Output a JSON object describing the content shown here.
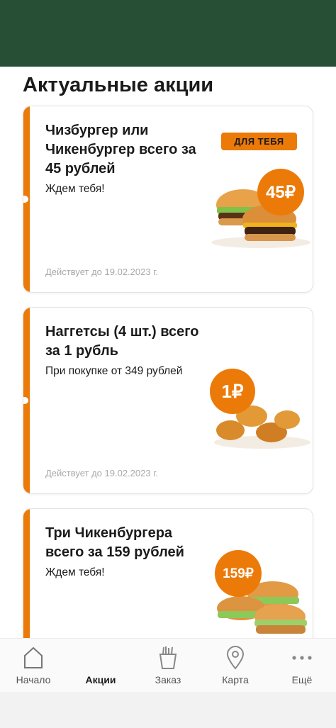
{
  "page": {
    "title": "Актуальные акции"
  },
  "promos": [
    {
      "title": "Чизбургер или Чикенбургер всего за 45 рублей",
      "subtitle": "Ждем тебя!",
      "validity": "Действует до 19.02.2023 г.",
      "badge": "ДЛЯ ТЕБЯ",
      "price": "45₽"
    },
    {
      "title": "Наггетсы (4 шт.) всего за 1 рубль",
      "subtitle": "При покупке от 349 рублей",
      "validity": "Действует до 19.02.2023 г.",
      "price": "1₽"
    },
    {
      "title": "Три Чикенбургера всего за 159 рублей",
      "subtitle": "Ждем тебя!",
      "price": "159₽"
    }
  ],
  "tabs": [
    {
      "label": "Начало",
      "icon": "home-icon"
    },
    {
      "label": "Акции",
      "icon": "promo-icon",
      "active": true
    },
    {
      "label": "Заказ",
      "icon": "fries-icon"
    },
    {
      "label": "Карта",
      "icon": "map-pin-icon"
    },
    {
      "label": "Ещё",
      "icon": "more-dots-icon"
    }
  ],
  "colors": {
    "header": "#264f36",
    "accent": "#ec7a08"
  }
}
